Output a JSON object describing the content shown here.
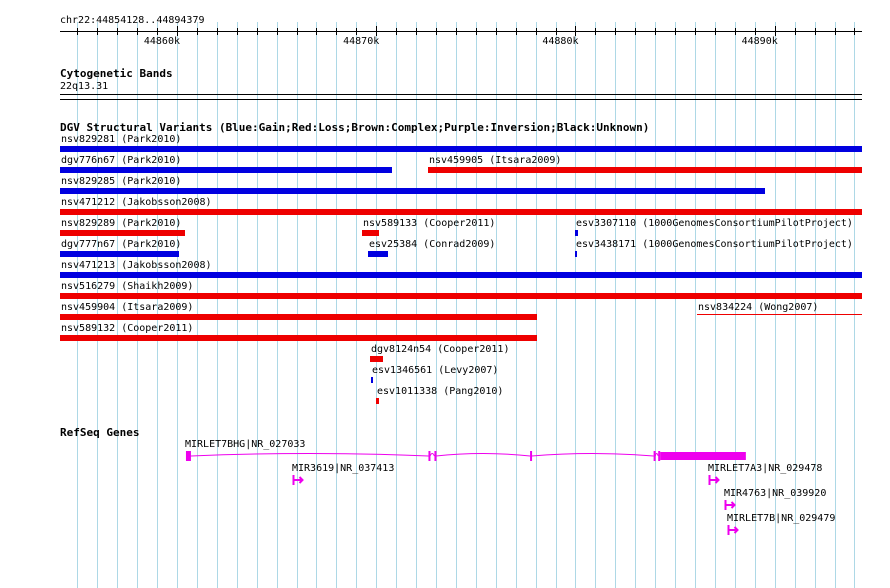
{
  "ruler": {
    "location": "chr22:44854128..44894379",
    "start": 44854128,
    "end": 44894379,
    "ticks": [
      {
        "pos": 44860000,
        "label": "44860k"
      },
      {
        "pos": 44870000,
        "label": "44870k"
      },
      {
        "pos": 44880000,
        "label": "44880k"
      },
      {
        "pos": 44890000,
        "label": "44890k"
      }
    ]
  },
  "cytobands": {
    "title": "Cytogenetic Bands",
    "band": "22q13.31"
  },
  "dgv": {
    "title": "DGV Structural Variants (Blue:Gain;Red:Loss;Brown:Complex;Purple:Inversion;Black:Unknown)",
    "colors": {
      "gain": "#0000e0",
      "loss": "#ee0000"
    },
    "features": [
      {
        "label": "nsv829281 (Park2010)",
        "start": 44854128,
        "end": 44894379,
        "type": "gain",
        "row": 0
      },
      {
        "label": "dgv776n67 (Park2010)",
        "start": 44854128,
        "end": 44870790,
        "type": "gain",
        "row": 1
      },
      {
        "label": "nsv459905 (Itsara2009)",
        "start": 44872600,
        "end": 44894379,
        "type": "loss",
        "row": 1
      },
      {
        "label": "nsv829285 (Park2010)",
        "start": 44854128,
        "end": 44889500,
        "type": "gain",
        "row": 2
      },
      {
        "label": "nsv471212 (Jakobsson2008)",
        "start": 44854128,
        "end": 44894379,
        "type": "loss",
        "row": 3
      },
      {
        "label": "nsv829289 (Park2010)",
        "start": 44854128,
        "end": 44860400,
        "type": "loss",
        "row": 4
      },
      {
        "label": "nsv589133 (Cooper2011)",
        "start": 44869300,
        "end": 44870150,
        "type": "loss",
        "row": 4
      },
      {
        "label": "esv3307110 (1000GenomesConsortiumPilotProject)",
        "start": 44879950,
        "end": 44880100,
        "type": "gain",
        "row": 4
      },
      {
        "label": "dgv777n67 (Park2010)",
        "start": 44854128,
        "end": 44860100,
        "type": "gain",
        "row": 5
      },
      {
        "label": "esv25384 (Conrad2009)",
        "start": 44869600,
        "end": 44870600,
        "type": "gain",
        "row": 5
      },
      {
        "label": "esv3438171 (1000GenomesConsortiumPilotProject)",
        "start": 44879950,
        "end": 44880050,
        "type": "gain",
        "row": 5
      },
      {
        "label": "nsv471213 (Jakobsson2008)",
        "start": 44854128,
        "end": 44894379,
        "type": "gain",
        "row": 6
      },
      {
        "label": "nsv516279 (Shaikh2009)",
        "start": 44854128,
        "end": 44894379,
        "type": "loss",
        "row": 7
      },
      {
        "label": "nsv459904 (Itsara2009)",
        "start": 44854128,
        "end": 44878050,
        "type": "loss",
        "row": 8
      },
      {
        "label": "nsv834224 (Wong2007)",
        "start": 44886100,
        "end": 44894379,
        "type": "loss",
        "row": 8,
        "thin": true
      },
      {
        "label": "nsv589132 (Cooper2011)",
        "start": 44854128,
        "end": 44878050,
        "type": "loss",
        "row": 9
      },
      {
        "label": "dgv8124n54 (Cooper2011)",
        "start": 44869700,
        "end": 44870350,
        "type": "loss",
        "row": 10
      },
      {
        "label": "esv1346561 (Levy2007)",
        "start": 44869760,
        "end": 44869860,
        "type": "gain",
        "row": 11
      },
      {
        "label": "esv1011338 (Pang2010)",
        "start": 44870000,
        "end": 44870150,
        "type": "loss",
        "row": 12
      }
    ]
  },
  "refseq": {
    "title": "RefSeq Genes",
    "color": "#ee00ee",
    "genes": [
      {
        "label": "MIRLET7BHG|NR_027033",
        "start": 44860450,
        "end": 44888550,
        "row": 0,
        "exons": [
          [
            44860450,
            44860700
          ],
          [
            44872620,
            44872700
          ],
          [
            44872920,
            44873000
          ],
          [
            44877720,
            44877800
          ],
          [
            44883920,
            44884000
          ],
          [
            44884150,
            44884250
          ],
          [
            44884250,
            44888550
          ]
        ]
      },
      {
        "label": "MIR3619|NR_037413",
        "start": 44865800,
        "end": 44866300,
        "row": 1,
        "arrow": true
      },
      {
        "label": "MIRLET7A3|NR_029478",
        "start": 44886700,
        "end": 44887200,
        "row": 1,
        "arrow": true
      },
      {
        "label": "MIR4763|NR_039920",
        "start": 44887500,
        "end": 44888000,
        "row": 2,
        "arrow": true
      },
      {
        "label": "MIRLET7B|NR_029479",
        "start": 44887650,
        "end": 44888150,
        "row": 3,
        "arrow": true
      }
    ]
  }
}
